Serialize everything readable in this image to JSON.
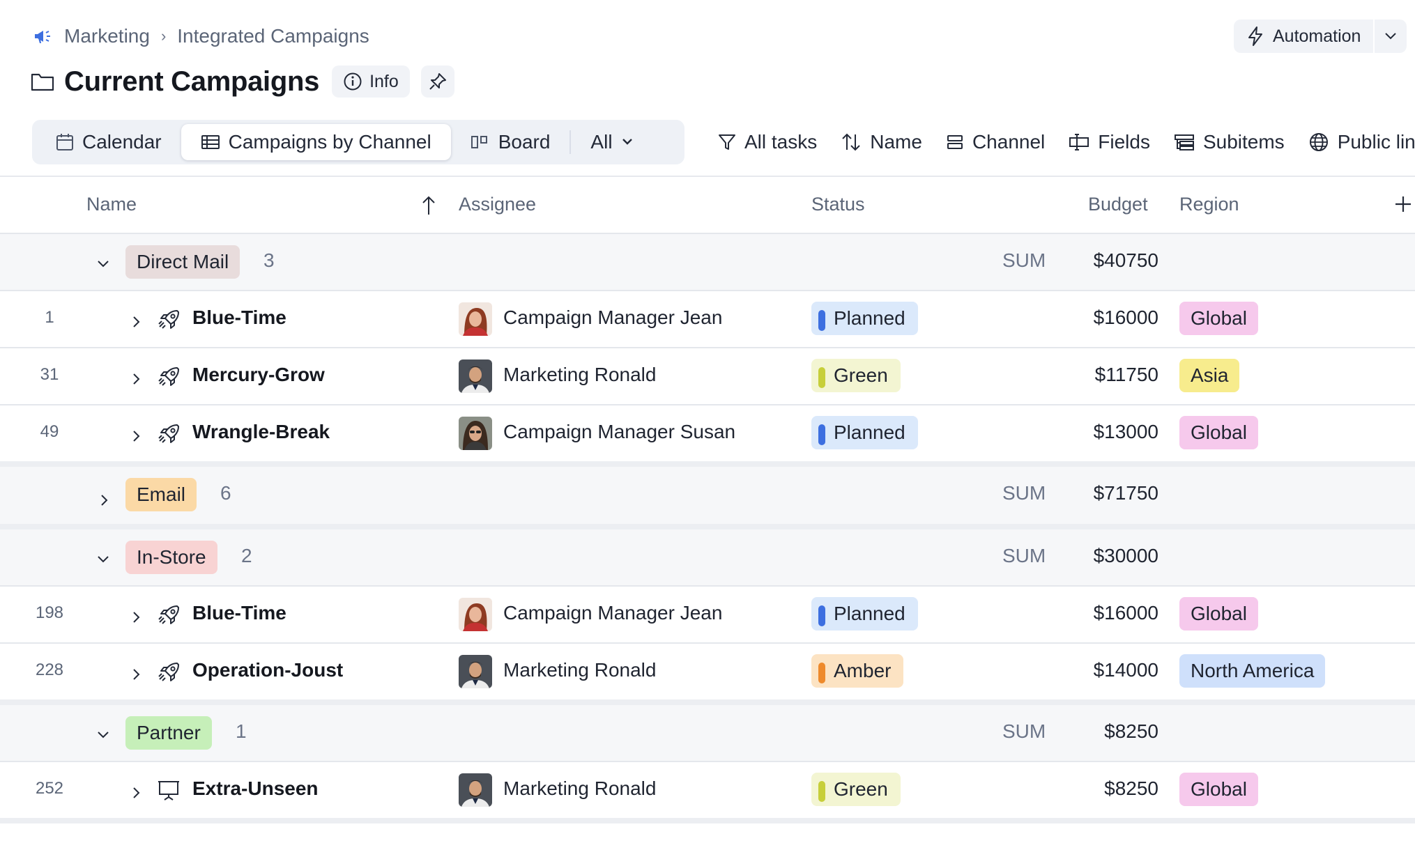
{
  "breadcrumb": {
    "parent": "Marketing",
    "current": "Integrated Campaigns"
  },
  "automation": {
    "label": "Automation"
  },
  "title": "Current Campaigns",
  "info_label": "Info",
  "tabs": [
    {
      "label": "Calendar",
      "icon": "calendar-icon"
    },
    {
      "label": "Campaigns by Channel",
      "icon": "table-icon"
    },
    {
      "label": "Board",
      "icon": "board-icon"
    },
    {
      "label": "All",
      "icon": "chevron-down-icon"
    }
  ],
  "tools": [
    {
      "label": "All tasks",
      "icon": "filter-icon"
    },
    {
      "label": "Name",
      "icon": "sort-icon"
    },
    {
      "label": "Channel",
      "icon": "group-icon"
    },
    {
      "label": "Fields",
      "icon": "fields-icon"
    },
    {
      "label": "Subitems",
      "icon": "subitems-icon"
    },
    {
      "label": "Public lin",
      "icon": "globe-icon"
    }
  ],
  "columns": {
    "name": "Name",
    "assignee": "Assignee",
    "status": "Status",
    "budget": "Budget",
    "region": "Region"
  },
  "sum_label": "SUM",
  "groups": [
    {
      "label": "Direct Mail",
      "count": "3",
      "sum": "$40750",
      "expanded": true,
      "color": "#e8dcdc",
      "rows": [
        {
          "num": "1",
          "name": "Blue-Time",
          "icon": "rocket-icon",
          "assignee": "Campaign Manager Jean",
          "avatar": "jean",
          "status": "Planned",
          "status_type": "planned",
          "budget": "$16000",
          "region": "Global",
          "region_type": "global"
        },
        {
          "num": "31",
          "name": "Mercury-Grow",
          "icon": "rocket-icon",
          "assignee": "Marketing Ronald",
          "avatar": "ronald",
          "status": "Green",
          "status_type": "green",
          "budget": "$11750",
          "region": "Asia",
          "region_type": "asia"
        },
        {
          "num": "49",
          "name": "Wrangle-Break",
          "icon": "rocket-icon",
          "assignee": "Campaign Manager Susan",
          "avatar": "susan",
          "status": "Planned",
          "status_type": "planned",
          "budget": "$13000",
          "region": "Global",
          "region_type": "global"
        }
      ]
    },
    {
      "label": "Email",
      "count": "6",
      "sum": "$71750",
      "expanded": false,
      "color": "#fbd9a6",
      "rows": []
    },
    {
      "label": "In-Store",
      "count": "2",
      "sum": "$30000",
      "expanded": true,
      "color": "#f8d3d3",
      "rows": [
        {
          "num": "198",
          "name": "Blue-Time",
          "icon": "rocket-icon",
          "assignee": "Campaign Manager Jean",
          "avatar": "jean",
          "status": "Planned",
          "status_type": "planned",
          "budget": "$16000",
          "region": "Global",
          "region_type": "global"
        },
        {
          "num": "228",
          "name": "Operation-Joust",
          "icon": "rocket-icon",
          "assignee": "Marketing Ronald",
          "avatar": "ronald",
          "status": "Amber",
          "status_type": "amber",
          "budget": "$14000",
          "region": "North America",
          "region_type": "na"
        }
      ]
    },
    {
      "label": "Partner",
      "count": "1",
      "sum": "$8250",
      "expanded": true,
      "color": "#c6efb9",
      "rows": [
        {
          "num": "252",
          "name": "Extra-Unseen",
          "icon": "presentation-icon",
          "assignee": "Marketing Ronald",
          "avatar": "ronald",
          "status": "Green",
          "status_type": "green",
          "budget": "$8250",
          "region": "Global",
          "region_type": "global"
        }
      ]
    }
  ],
  "colors": {
    "planned_bg": "#dbe9fb",
    "planned_bar": "#3d6fe0",
    "green_bg": "#f3f5d2",
    "green_bar": "#c7cf3a",
    "amber_bg": "#fce3c3",
    "amber_bar": "#ee8a2c",
    "global_bg": "#f6c9ec",
    "asia_bg": "#f7ec8d",
    "na_bg": "#cfe0fb"
  }
}
